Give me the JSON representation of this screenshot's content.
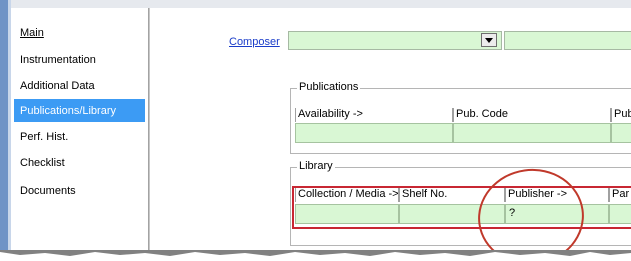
{
  "sidebar": {
    "items": [
      {
        "label": "Main"
      },
      {
        "label": "Instrumentation"
      },
      {
        "label": "Additional Data"
      },
      {
        "label": "Publications/Library"
      },
      {
        "label": "Perf. Hist."
      },
      {
        "label": "Checklist"
      },
      {
        "label": "Documents"
      }
    ],
    "active_index": 3
  },
  "composer": {
    "label": "Composer",
    "value": ""
  },
  "publications": {
    "title": "Publications",
    "columns": [
      "Availability ->",
      "Pub. Code",
      "Pub"
    ],
    "row": [
      "",
      "",
      ""
    ]
  },
  "library": {
    "title": "Library",
    "columns": [
      "Collection / Media ->",
      "Shelf No.",
      "Publisher ->",
      "Par"
    ],
    "row": [
      "",
      "",
      "?",
      ""
    ]
  },
  "colors": {
    "accent": "#3c9bf4",
    "field_green": "#d9f7d4",
    "highlight_red": "#c82733"
  }
}
